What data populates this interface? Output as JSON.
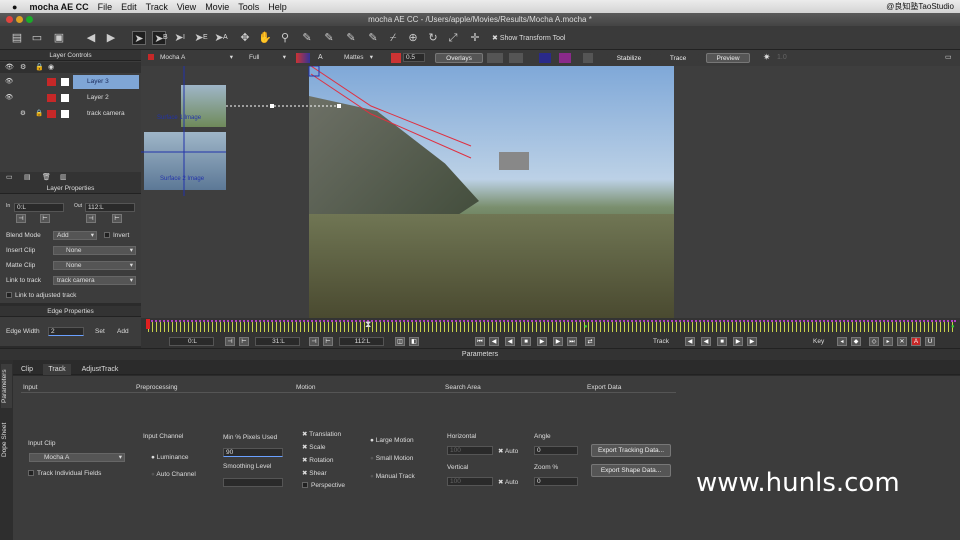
{
  "menubar": {
    "app": "mocha AE CC",
    "items": [
      "File",
      "Edit",
      "Track",
      "View",
      "Movie",
      "Tools",
      "Help"
    ],
    "right": "@良知塾TaoStudio"
  },
  "window_title": "mocha AE CC - /Users/apple/Movies/Results/Mocha A.mocha *",
  "toolbar": {
    "tool_labels": [
      "B",
      "I",
      "E",
      "A"
    ],
    "show_transform": "Show Transform Tool"
  },
  "viewer_bar": {
    "clip": "Mocha A",
    "quality": "Full",
    "mattes": "Mattes",
    "opacity": "0.5",
    "overlays": "Overlays",
    "stabilize": "Stabilize",
    "trace": "Trace",
    "preview": "Preview",
    "a_label": "A",
    "extra": "1.0"
  },
  "layer_controls": {
    "title": "Layer Controls",
    "layers": [
      "Layer 3",
      "Layer 2",
      "track camera"
    ]
  },
  "layer_properties": {
    "title": "Layer Properties",
    "in_label": "In",
    "in_value": "0:L",
    "out_label": "Out",
    "out_value": "112:L",
    "blend_label": "Blend Mode",
    "blend_value": "Add",
    "invert": "Invert",
    "insert_label": "Insert Clip",
    "insert_value": "None",
    "matte_label": "Matte Clip",
    "matte_value": "None",
    "link_label": "Link to track",
    "link_value": "track camera",
    "link_adjusted": "Link to adjusted track"
  },
  "edge_properties": {
    "title": "Edge Properties",
    "width_label": "Edge Width",
    "width_value": "2",
    "set": "Set",
    "add": "Add"
  },
  "overlay_labels": {
    "thumb1": "Surface 1 Image",
    "thumb2": "Surface 2 Image"
  },
  "timeline": {
    "start": "0:L",
    "current": "31:L",
    "end": "112:L",
    "track": "Track",
    "key": "Key",
    "playhead_fraction": 0.28
  },
  "parameters": {
    "title": "Parameters",
    "side_tabs": [
      "Parameters",
      "Dope Sheet"
    ],
    "tabs": [
      "Clip",
      "Track",
      "AdjustTrack"
    ],
    "sections": {
      "input": "Input",
      "preprocessing": "Preprocessing",
      "motion": "Motion",
      "search_area": "Search Area",
      "export": "Export Data"
    },
    "input_clip_label": "Input Clip",
    "input_clip_value": "Mocha A",
    "track_individual": "Track Individual Fields",
    "input_channel": "Input Channel",
    "luminance": "Luminance",
    "auto_channel": "Auto Channel",
    "min_pixels_label": "Min % Pixels Used",
    "min_pixels_value": "90",
    "smoothing_label": "Smoothing Level",
    "motion_items": [
      "Translation",
      "Scale",
      "Rotation",
      "Shear",
      "Perspective"
    ],
    "motion_types": [
      "Large Motion",
      "Small Motion",
      "Manual Track"
    ],
    "horizontal": "Horizontal",
    "horizontal_value": "100",
    "vertical": "Vertical",
    "vertical_value": "100",
    "auto": "Auto",
    "angle": "Angle",
    "angle_value": "0",
    "zoom": "Zoom %",
    "zoom_value": "0",
    "export_tracking": "Export Tracking Data...",
    "export_shape": "Export Shape Data..."
  },
  "watermark": "www.hunls.com"
}
